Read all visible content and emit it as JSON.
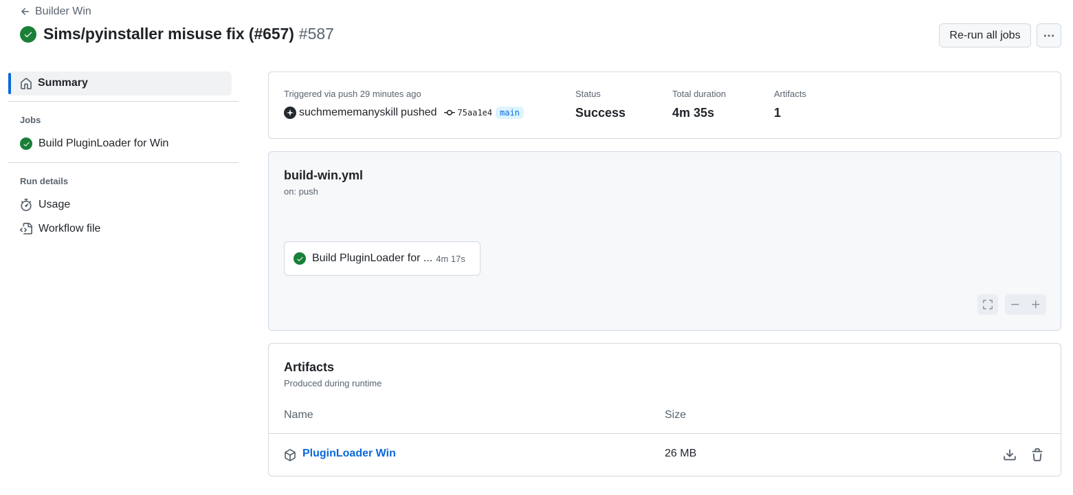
{
  "header": {
    "back_label": "Builder Win",
    "title": "Sims/pyinstaller misuse fix (#657)",
    "run_number": "#587",
    "rerun_label": "Re-run all jobs",
    "status_color": "#1a7f37"
  },
  "sidebar": {
    "summary_label": "Summary",
    "jobs_heading": "Jobs",
    "jobs": [
      {
        "label": "Build PluginLoader for Win",
        "status": "success"
      }
    ],
    "run_details_heading": "Run details",
    "details": [
      {
        "label": "Usage",
        "icon": "stopwatch-icon"
      },
      {
        "label": "Workflow file",
        "icon": "file-code-icon"
      }
    ]
  },
  "run_info": {
    "trigger_text": "Triggered via push 29 minutes ago",
    "user": "suchmememanyskill",
    "verb": "pushed",
    "commit_sha": "75aa1e4",
    "branch": "main",
    "status_label": "Status",
    "status_value": "Success",
    "duration_label": "Total duration",
    "duration_value": "4m 35s",
    "artifacts_label": "Artifacts",
    "artifacts_value": "1"
  },
  "graph": {
    "workflow_file": "build-win.yml",
    "trigger": "on: push",
    "job_name": "Build PluginLoader for ...",
    "job_duration": "4m 17s"
  },
  "artifacts": {
    "title": "Artifacts",
    "subtitle": "Produced during runtime",
    "col_name": "Name",
    "col_size": "Size",
    "rows": [
      {
        "name": "PluginLoader Win",
        "size": "26 MB"
      }
    ]
  },
  "colors": {
    "accent": "#0969da",
    "success": "#1a7f37",
    "muted": "#59636e",
    "border": "#d1d9e0"
  }
}
